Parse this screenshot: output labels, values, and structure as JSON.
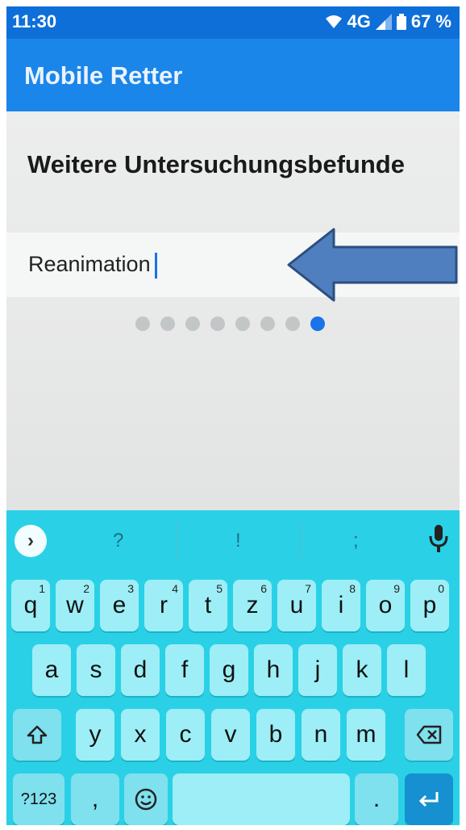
{
  "status": {
    "time": "11:30",
    "network": "4G",
    "battery": "67 %"
  },
  "app": {
    "title": "Mobile Retter"
  },
  "page": {
    "heading": "Weitere Untersuchungsbefunde",
    "input_value": "Reanimation",
    "dots_total": 8,
    "dots_active_index": 7
  },
  "keyboard": {
    "suggestions": [
      "?",
      "!",
      ";"
    ],
    "row1": [
      {
        "k": "q",
        "n": "1"
      },
      {
        "k": "w",
        "n": "2"
      },
      {
        "k": "e",
        "n": "3"
      },
      {
        "k": "r",
        "n": "4"
      },
      {
        "k": "t",
        "n": "5"
      },
      {
        "k": "z",
        "n": "6"
      },
      {
        "k": "u",
        "n": "7"
      },
      {
        "k": "i",
        "n": "8"
      },
      {
        "k": "o",
        "n": "9"
      },
      {
        "k": "p",
        "n": "0"
      }
    ],
    "row2": [
      "a",
      "s",
      "d",
      "f",
      "g",
      "h",
      "j",
      "k",
      "l"
    ],
    "row3": [
      "y",
      "x",
      "c",
      "v",
      "b",
      "n",
      "m"
    ],
    "symbols_label": "?123",
    "comma_label": ",",
    "period_label": "."
  },
  "colors": {
    "status_bar": "#0f6fd8",
    "app_bar": "#1b86ea",
    "accent": "#1a73e8",
    "keyboard": "#2ad1e6"
  },
  "icons": [
    "wifi-icon",
    "signal-icon",
    "battery-icon",
    "arrow-annotation-icon",
    "chevron-right-icon",
    "mic-icon",
    "shift-icon",
    "backspace-icon",
    "emoji-icon",
    "enter-icon"
  ]
}
